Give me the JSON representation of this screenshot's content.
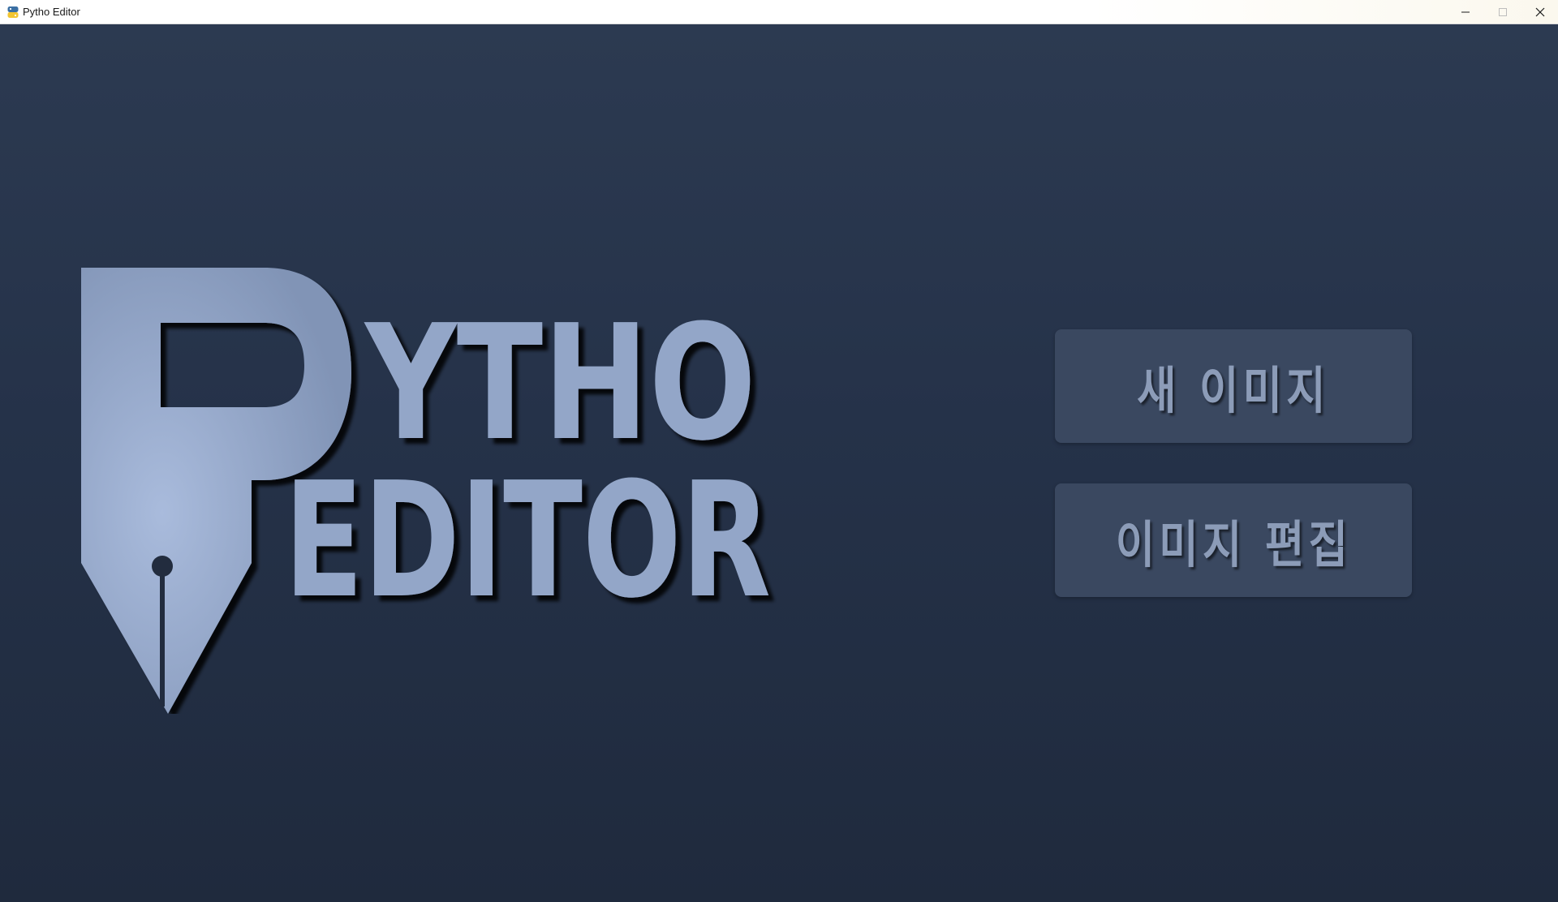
{
  "window": {
    "title": "Pytho Editor",
    "icons": {
      "app": "python-logo-icon",
      "minimize": "minimize-icon",
      "maximize": "maximize-icon",
      "close": "close-icon"
    }
  },
  "logo": {
    "line1": "YTHO",
    "line2": "EDITOR",
    "monogram": "P",
    "icon": "fountain-pen-nib-icon",
    "color": "#93a6c8"
  },
  "menu": {
    "new_image_label": "새 이미지",
    "edit_image_label": "이미지 편집"
  },
  "colors": {
    "background_top": "#2c3a51",
    "background_bottom": "#1f2a3d",
    "button_bg": "#3a4860",
    "button_text": "#8c9cb8"
  }
}
